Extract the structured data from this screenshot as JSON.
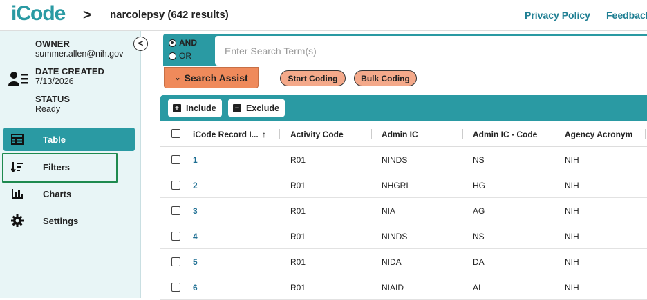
{
  "header": {
    "logo_text": "iCode",
    "query_title": "narcolepsy (642 results)",
    "links": [
      "Privacy Policy",
      "Feedback"
    ]
  },
  "sidebar": {
    "owner_label": "OWNER",
    "owner_value": "summer.allen@nih.gov",
    "date_label": "DATE CREATED",
    "date_value": "7/13/2026",
    "status_label": "STATUS",
    "status_value": "Ready",
    "nav": [
      {
        "label": "Table",
        "icon": "table-icon",
        "active": true
      },
      {
        "label": "Filters",
        "icon": "filter-sort-icon",
        "active": false
      },
      {
        "label": "Charts",
        "icon": "bar-chart-icon",
        "active": false
      },
      {
        "label": "Settings",
        "icon": "gear-icon",
        "active": false
      }
    ]
  },
  "search": {
    "and_label": "AND",
    "or_label": "OR",
    "placeholder": "Enter Search Term(s)",
    "assist_label": "Search Assist",
    "start_coding_label": "Start Coding",
    "bulk_coding_label": "Bulk Coding"
  },
  "grid": {
    "include_label": "Include",
    "exclude_label": "Exclude",
    "columns": [
      "iCode Record I...",
      "Activity Code",
      "Admin IC",
      "Admin IC - Code",
      "Agency Acronym"
    ],
    "sort_indicator": "↑",
    "rows": [
      [
        "1",
        "R01",
        "NINDS",
        "NS",
        "NIH"
      ],
      [
        "2",
        "R01",
        "NHGRI",
        "HG",
        "NIH"
      ],
      [
        "3",
        "R01",
        "NIA",
        "AG",
        "NIH"
      ],
      [
        "4",
        "R01",
        "NINDS",
        "NS",
        "NIH"
      ],
      [
        "5",
        "R01",
        "NIDA",
        "DA",
        "NIH"
      ],
      [
        "6",
        "R01",
        "NIAID",
        "AI",
        "NIH"
      ]
    ]
  },
  "colors": {
    "brand": "#2a9aa3",
    "accent_orange": "#ef8a5b",
    "highlight_green": "#1e8a4f"
  }
}
